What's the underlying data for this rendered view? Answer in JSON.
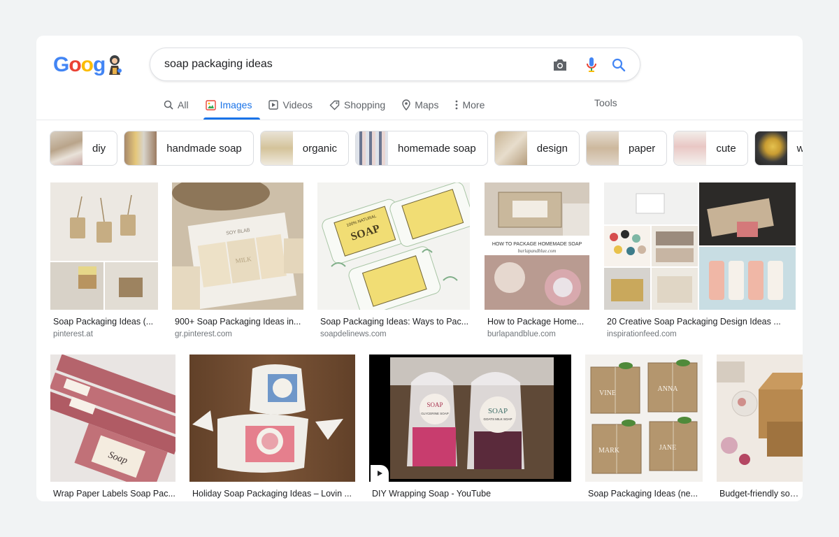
{
  "search": {
    "query": "soap packaging ideas"
  },
  "logo": {
    "text": [
      "G",
      "o",
      "o",
      "g"
    ]
  },
  "tabs": [
    {
      "label": "All",
      "icon": "search-icon"
    },
    {
      "label": "Images",
      "icon": "image-icon",
      "active": true
    },
    {
      "label": "Videos",
      "icon": "play-icon"
    },
    {
      "label": "Shopping",
      "icon": "tag-icon"
    },
    {
      "label": "Maps",
      "icon": "map-pin-icon"
    },
    {
      "label": "More",
      "icon": "more-vertical-icon"
    }
  ],
  "tools_label": "Tools",
  "chips": [
    {
      "label": "diy"
    },
    {
      "label": "handmade soap"
    },
    {
      "label": "organic"
    },
    {
      "label": "homemade soap"
    },
    {
      "label": "design"
    },
    {
      "label": "paper"
    },
    {
      "label": "cute"
    },
    {
      "label": "wra"
    }
  ],
  "results": [
    {
      "title": "Soap Packaging Ideas (...",
      "domain": "pinterest.at"
    },
    {
      "title": "900+ Soap Packaging Ideas in...",
      "domain": "gr.pinterest.com"
    },
    {
      "title": "Soap Packaging Ideas: Ways to Pac...",
      "domain": "soapdelinews.com"
    },
    {
      "title": "How to Package Home...",
      "domain": "burlapandblue.com"
    },
    {
      "title": "20 Creative Soap Packaging Design Ideas ...",
      "domain": "inspirationfeed.com"
    },
    {
      "title": "Wrap Paper Labels Soap Pac...",
      "domain": ""
    },
    {
      "title": "Holiday Soap Packaging Ideas – Lovin ...",
      "domain": ""
    },
    {
      "title": "DIY Wrapping Soap - YouTube",
      "domain": ""
    },
    {
      "title": "Soap Packaging Ideas (ne...",
      "domain": ""
    },
    {
      "title": "Budget-friendly soap ...",
      "domain": ""
    }
  ],
  "image_texts": {
    "r2_label": "SOY BLAB",
    "r2_milk": "MILK",
    "r3_soap": "SOAP",
    "r3_natural": "100% NATURAL",
    "r4_caption": "HOW TO PACKAGE HOMEMADE SOAP",
    "r4_site": "burlapandblue.com",
    "r6_soap": "Soap",
    "r8_soap": "SOAP",
    "r8_glycerine": "GLYCERINE SOAP",
    "r8_goats": "GOATS MILK SOAP",
    "r9_names": [
      "VINE",
      "ANNA",
      "MARK",
      "JANE"
    ]
  },
  "colors": {
    "accent": "#1a73e8",
    "text": "#202124",
    "muted": "#70757a"
  }
}
